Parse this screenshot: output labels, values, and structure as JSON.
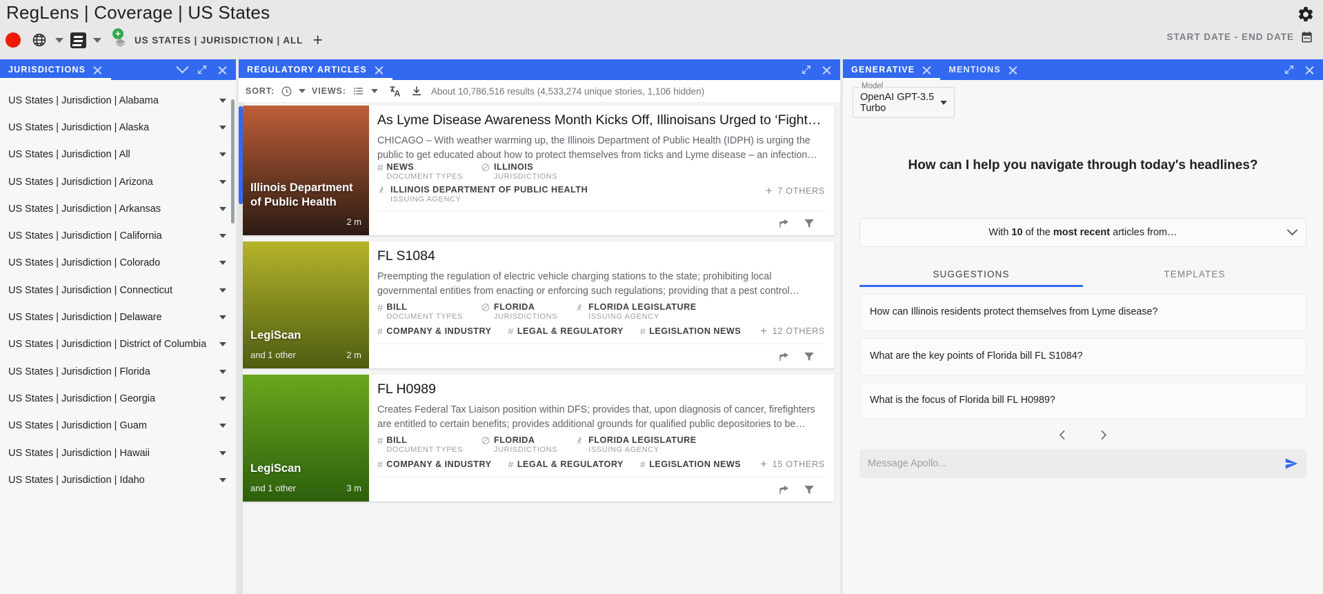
{
  "header": {
    "title": "RegLens | Coverage | US States",
    "gear_icon": "gear-icon",
    "record_dot": "record-indicator",
    "globe_icon": "globe-icon",
    "doc_icon": "document-icon",
    "layers_icon": "layers-add-icon",
    "context_label": "US STATES | JURISDICTION | ALL",
    "add_label": "+",
    "date_range_label": "START DATE - END DATE",
    "calendar_icon": "calendar-icon"
  },
  "left_panel": {
    "tab_label": "JURISDICTIONS",
    "items": [
      "US States | Jurisdiction | Alabama",
      "US States | Jurisdiction | Alaska",
      "US States | Jurisdiction | All",
      "US States | Jurisdiction | Arizona",
      "US States | Jurisdiction | Arkansas",
      "US States | Jurisdiction | California",
      "US States | Jurisdiction | Colorado",
      "US States | Jurisdiction | Connecticut",
      "US States | Jurisdiction | Delaware",
      "US States | Jurisdiction | District of Columbia",
      "US States | Jurisdiction | Florida",
      "US States | Jurisdiction | Georgia",
      "US States | Jurisdiction | Guam",
      "US States | Jurisdiction | Hawaii",
      "US States | Jurisdiction | Idaho"
    ]
  },
  "center_panel": {
    "tab_label": "REGULATORY ARTICLES",
    "toolbar": {
      "sort_label": "SORT:",
      "sort_icon": "clock-icon",
      "views_label": "VIEWS:",
      "views_icon": "list-icon",
      "translate_icon": "translate-icon",
      "download_icon": "download-icon",
      "results_text": "About 10,786,516 results (4,533,274 unique stories, 1,106 hidden)"
    },
    "cards": [
      {
        "source": "Illinois Department of Public Health",
        "source_sub": "",
        "age": "2 m",
        "title": "As Lyme Disease Awareness Month Kicks Off, Illinoisans Urged to ‘Fight…",
        "description": "CHICAGO – With weather warming up, the Illinois Department of Public Health (IDPH) is urging the public to get educated about how to protect themselves from ticks and Lyme disease – an infection…",
        "meta": [
          {
            "value": "NEWS",
            "key": "DOCUMENT TYPES",
            "icon": "hash-icon"
          },
          {
            "value": "ILLINOIS",
            "key": "JURISDICTIONS",
            "icon": "jurisdiction-icon"
          }
        ],
        "meta2": [
          {
            "value": "ILLINOIS DEPARTMENT OF PUBLIC HEALTH",
            "key": "ISSUING AGENCY",
            "icon": "agency-icon"
          }
        ],
        "tags": [],
        "others": "7 OTHERS",
        "gradient_from": "#bf5e38",
        "gradient_to": "#2b1b12"
      },
      {
        "source": "LegiScan",
        "source_sub": "and 1 other",
        "age": "2 m",
        "title": "FL S1084",
        "description": "Preempting the regulation of electric vehicle charging stations to the state; prohibiting local governmental entities from enacting or enforcing such regulations; providing that a pest control…",
        "meta": [
          {
            "value": "BILL",
            "key": "DOCUMENT TYPES",
            "icon": "hash-icon"
          },
          {
            "value": "FLORIDA",
            "key": "JURISDICTIONS",
            "icon": "jurisdiction-icon"
          },
          {
            "value": "FLORIDA LEGISLATURE",
            "key": "ISSUING AGENCY",
            "icon": "agency-icon"
          }
        ],
        "meta2": [],
        "tags": [
          "COMPANY & INDUSTRY",
          "LEGAL & REGULATORY",
          "LEGISLATION NEWS"
        ],
        "others": "12 OTHERS",
        "gradient_from": "#b5b52a",
        "gradient_to": "#4d5c10"
      },
      {
        "source": "LegiScan",
        "source_sub": "and 1 other",
        "age": "3 m",
        "title": "FL H0989",
        "description": "Creates Federal Tax Liaison position within DFS; provides that, upon diagnosis of cancer, firefighters are entitled to certain benefits; provides additional grounds for qualified public depositories to be…",
        "meta": [
          {
            "value": "BILL",
            "key": "DOCUMENT TYPES",
            "icon": "hash-icon"
          },
          {
            "value": "FLORIDA",
            "key": "JURISDICTIONS",
            "icon": "jurisdiction-icon"
          },
          {
            "value": "FLORIDA LEGISLATURE",
            "key": "ISSUING AGENCY",
            "icon": "agency-icon"
          }
        ],
        "meta2": [],
        "tags": [
          "COMPANY & INDUSTRY",
          "LEGAL & REGULATORY",
          "LEGISLATION NEWS"
        ],
        "others": "15 OTHERS",
        "gradient_from": "#6aa81e",
        "gradient_to": "#2d5f0c"
      }
    ],
    "card_actions": {
      "share_icon": "share-icon",
      "filter_icon": "filter-icon"
    }
  },
  "right_panel": {
    "tabs": [
      {
        "label": "GENERATIVE",
        "active": true
      },
      {
        "label": "MENTIONS",
        "active": false
      }
    ],
    "model": {
      "legend": "Model",
      "value": "OpenAI GPT-3.5 Turbo"
    },
    "prompt_heading": "How can I help you navigate through today's headlines?",
    "context_selector": {
      "prefix": "With ",
      "count": "10",
      "mid": " of the ",
      "emphasis": "most recent",
      "suffix": " articles from…"
    },
    "sub_tabs": [
      {
        "label": "SUGGESTIONS",
        "active": true
      },
      {
        "label": "TEMPLATES",
        "active": false
      }
    ],
    "suggestions": [
      "How can Illinois residents protect themselves from Lyme disease?",
      "What are the key points of Florida bill FL S1084?",
      "What is the focus of Florida bill FL H0989?"
    ],
    "pager": {
      "prev_icon": "chevron-left-icon",
      "next_icon": "chevron-right-icon"
    },
    "message": {
      "placeholder": "Message Apollo...",
      "value": "",
      "send_icon": "send-icon"
    }
  },
  "colors": {
    "accent": "#3269f0",
    "record": "#f01800",
    "badge_green": "#34a853",
    "page_bg": "#e8e8e8"
  }
}
